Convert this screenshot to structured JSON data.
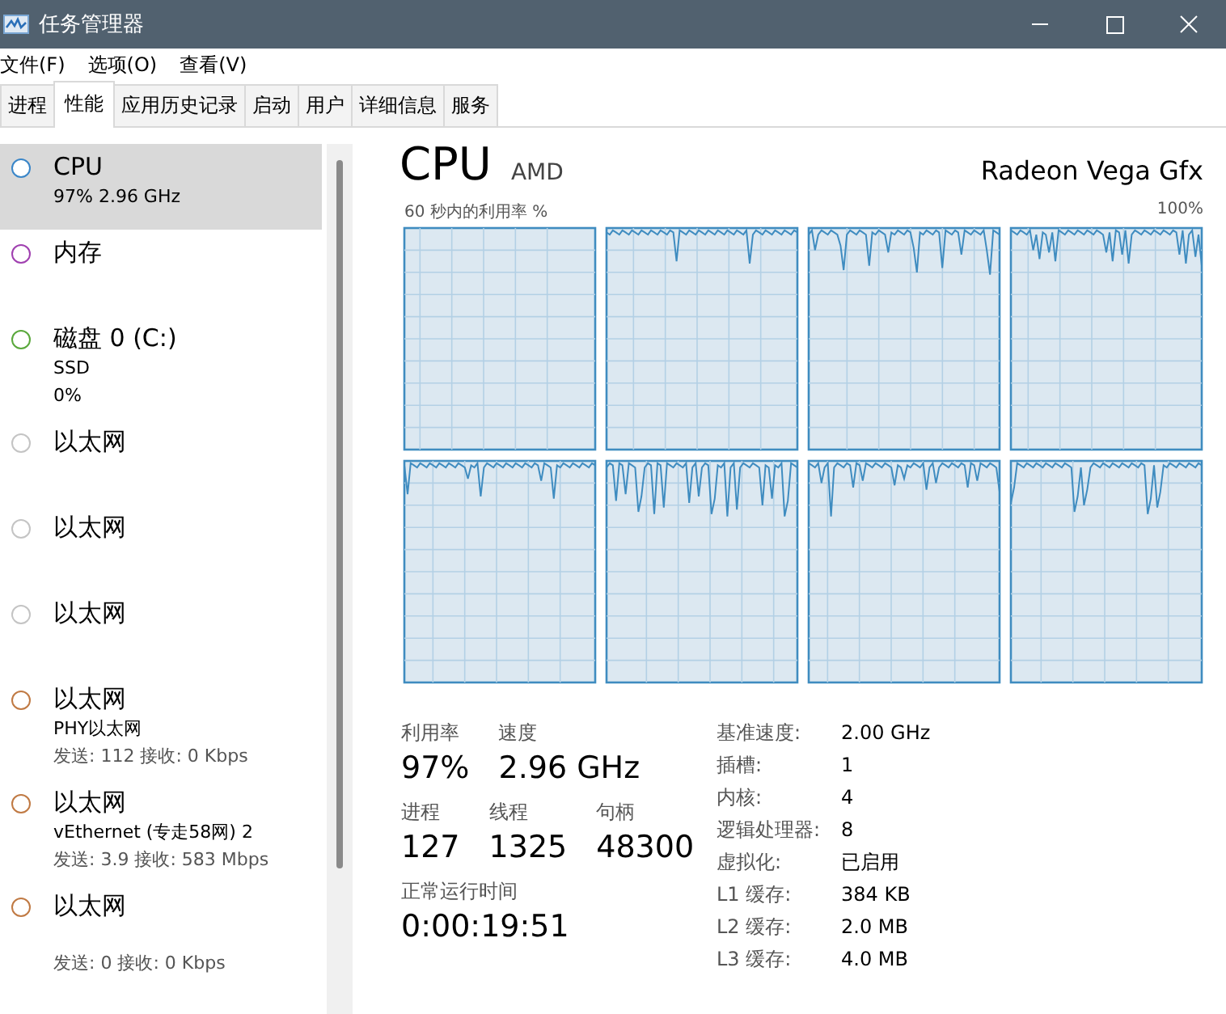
{
  "window": {
    "title": "任务管理器"
  },
  "menu": [
    "文件(F)",
    "选项(O)",
    "查看(V)"
  ],
  "tabs": [
    {
      "label": "进程",
      "selected": false
    },
    {
      "label": "性能",
      "selected": true
    },
    {
      "label": "应用历史记录",
      "selected": false
    },
    {
      "label": "启动",
      "selected": false
    },
    {
      "label": "用户",
      "selected": false
    },
    {
      "label": "详细信息",
      "selected": false
    },
    {
      "label": "服务",
      "selected": false
    }
  ],
  "sidebar": {
    "items": [
      {
        "title": "CPU",
        "subtitle": "97% 2.96 GHz",
        "color": "#3a86c8",
        "selected": true
      },
      {
        "title": "内存",
        "color": "#a040b0",
        "selected": false
      },
      {
        "title": "磁盘 0 (C:)",
        "subtitle": "SSD",
        "reading": "0%",
        "color": "#5aa83c",
        "selected": false
      },
      {
        "title": "以太网",
        "color": "#c4c4c4",
        "selected": false
      },
      {
        "title": "以太网",
        "color": "#c4c4c4",
        "selected": false
      },
      {
        "title": "以太网",
        "color": "#c4c4c4",
        "selected": false
      },
      {
        "title": "以太网",
        "subtitle": "PHY以太网",
        "traffic": "发送: 112 接收: 0 Kbps",
        "color": "#c07a44",
        "selected": false
      },
      {
        "title": "以太网",
        "subtitle": "vEthernet (专走58网) 2",
        "traffic": "发送: 3.9 接收: 583 Mbps",
        "color": "#c07a44",
        "selected": false
      },
      {
        "title": "以太网",
        "traffic": "发送: 0 接收: 0 Kbps",
        "color": "#c07a44",
        "selected": false
      }
    ]
  },
  "detail": {
    "title": "CPU",
    "model_left": "AMD",
    "model_right": "Radeon Vega Gfx",
    "graph_caption": "60 秒内的利用率 %",
    "graph_max": "100%",
    "stats": [
      [
        {
          "label": "利用率",
          "value": "97%"
        },
        {
          "label": "速度",
          "value": "2.96 GHz"
        }
      ],
      [
        {
          "label": "进程",
          "value": "127"
        },
        {
          "label": "线程",
          "value": "1325"
        },
        {
          "label": "句柄",
          "value": "48300"
        }
      ],
      [
        {
          "label": "正常运行时间",
          "value": "0:00:19:51"
        }
      ]
    ],
    "specs": [
      {
        "label": "基准速度:",
        "value": "2.00 GHz"
      },
      {
        "label": "插槽:",
        "value": "1"
      },
      {
        "label": "内核:",
        "value": "4"
      },
      {
        "label": "逻辑处理器:",
        "value": "8"
      },
      {
        "label": "虚拟化:",
        "value": "已启用"
      },
      {
        "label": "L1 缓存:",
        "value": "384 KB"
      },
      {
        "label": "L2 缓存:",
        "value": "2.0 MB"
      },
      {
        "label": "L3 缓存:",
        "value": "4.0 MB"
      }
    ]
  }
}
